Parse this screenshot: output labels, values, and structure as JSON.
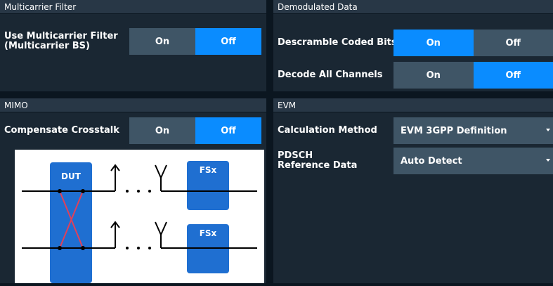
{
  "multicarrier": {
    "header": "Multicarrier Filter",
    "use_filter_label": "Use Multicarrier Filter\n(Multicarrier BS)",
    "on_label": "On",
    "off_label": "Off",
    "active": "Off"
  },
  "demodulated": {
    "header": "Demodulated Data",
    "descramble_label": "Descramble Coded Bits",
    "descramble_on": "On",
    "descramble_off": "Off",
    "descramble_active": "On",
    "decode_label": "Decode All Channels",
    "decode_on": "On",
    "decode_off": "Off",
    "decode_active": "Off"
  },
  "mimo": {
    "header": "MIMO",
    "crosstalk_label": "Compensate Crosstalk",
    "on_label": "On",
    "off_label": "Off",
    "active": "Off",
    "diagram": {
      "dut_label": "DUT",
      "fsx_label_1": "FSx",
      "fsx_label_2": "FSx"
    }
  },
  "evm": {
    "header": "EVM",
    "calc_label": "Calculation Method",
    "calc_value": "EVM 3GPP Definition",
    "pdsch_label": "PDSCH\nReference Data",
    "pdsch_value": "Auto Detect"
  },
  "colors": {
    "panel_bg": "#1a2733",
    "header_bg": "#283746",
    "toggle_bg": "#3f5566",
    "active_blue": "#0a8cff",
    "diagram_block": "#1f6fd1",
    "crosstalk_red": "#e0405a"
  }
}
